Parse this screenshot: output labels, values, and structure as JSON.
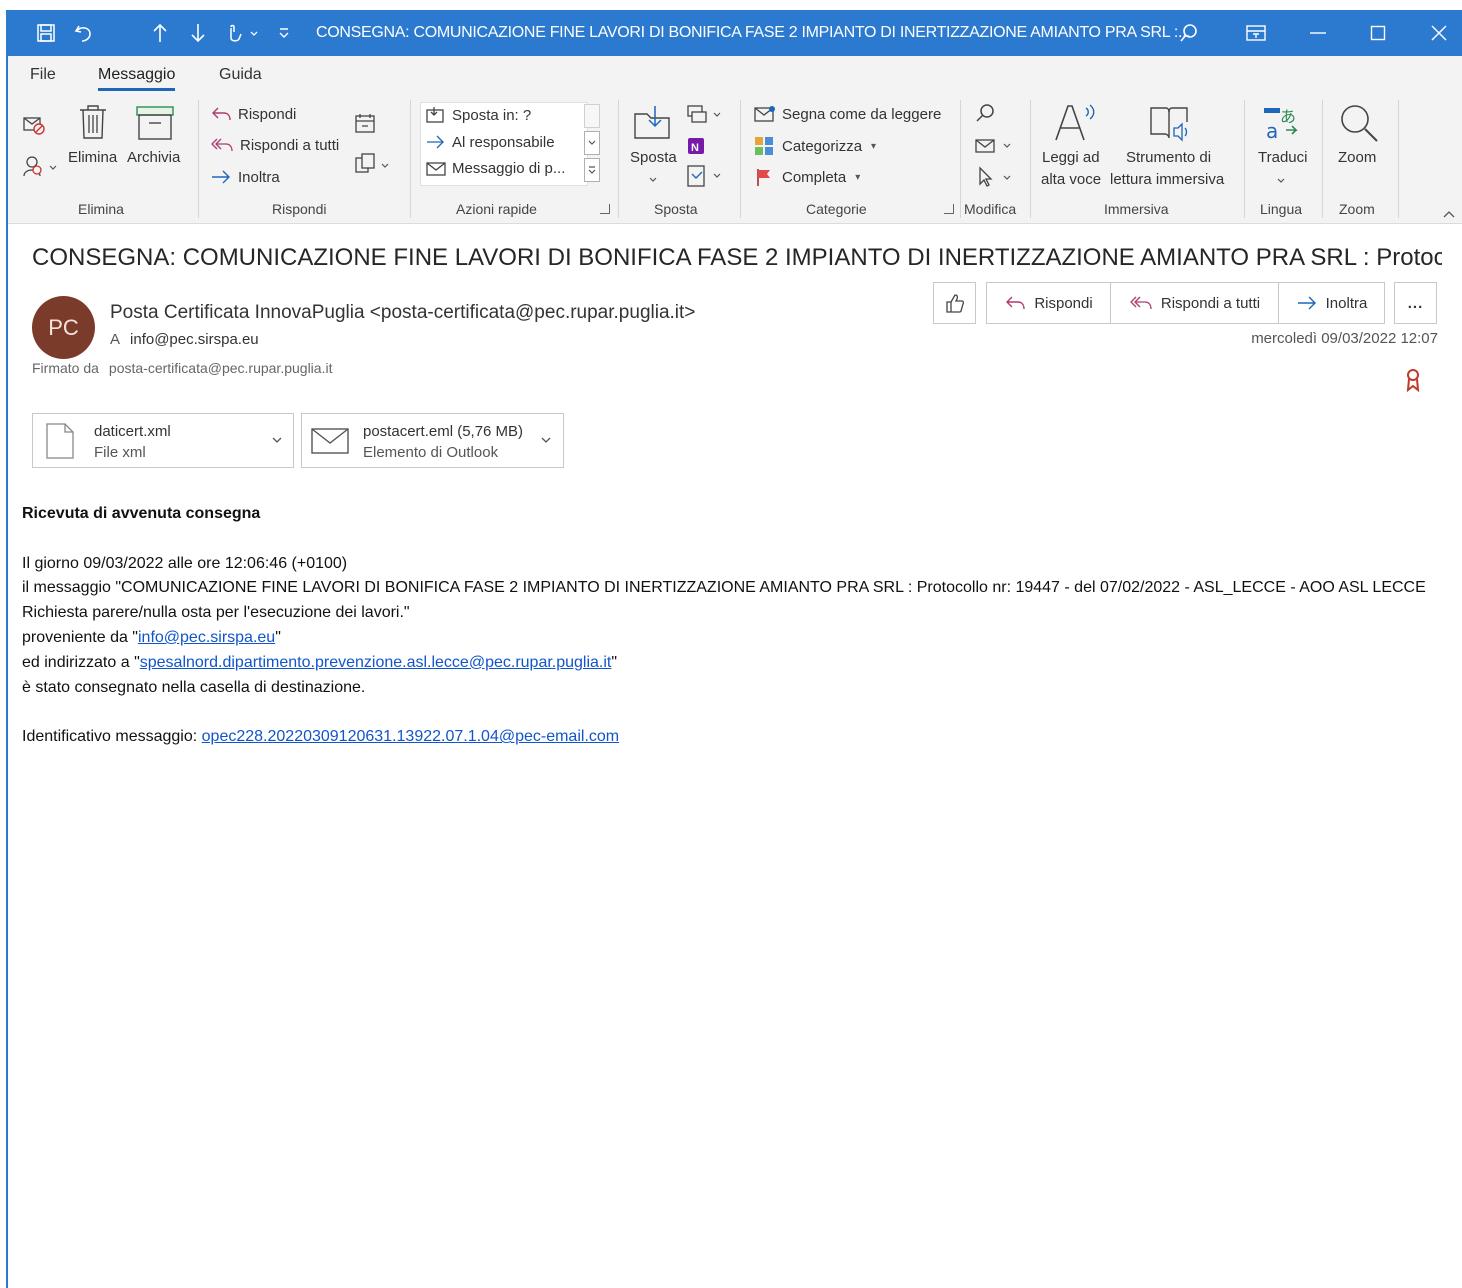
{
  "window": {
    "title": "CONSEGNA: COMUNICAZIONE FINE LAVORI DI BONIFICA FASE 2 IMPIANTO DI INERTIZZAZIONE AMIANTO PRA SRL :...",
    "accent_color": "#2b7ad0"
  },
  "menu": {
    "tabs": [
      "File",
      "Messaggio",
      "Guida"
    ],
    "active": "Messaggio"
  },
  "ribbon": {
    "elimina": {
      "delete_label": "Elimina",
      "archive_label": "Archivia",
      "group": "Elimina"
    },
    "rispondi": {
      "reply": "Rispondi",
      "reply_all": "Rispondi a tutti",
      "forward": "Inoltra",
      "group": "Rispondi"
    },
    "azioni_rapide": {
      "move_to": "Sposta in: ?",
      "to_manager": "Al responsabile",
      "team_email": "Messaggio di p...",
      "group": "Azioni rapide"
    },
    "sposta": {
      "move_label": "Sposta",
      "group": "Sposta"
    },
    "categorie": {
      "mark_unread": "Segna come da leggere",
      "categorize": "Categorizza",
      "follow_up": "Completa",
      "group": "Categorie"
    },
    "modifica": {
      "group": "Modifica"
    },
    "immersiva": {
      "read_aloud_line1": "Leggi ad",
      "read_aloud_line2": "alta voce",
      "immersive_line1": "Strumento di",
      "immersive_line2": "lettura immersiva",
      "group": "Immersiva"
    },
    "lingua": {
      "translate": "Traduci",
      "group": "Lingua"
    },
    "zoom": {
      "zoom_label": "Zoom",
      "group": "Zoom"
    }
  },
  "message": {
    "subject": "CONSEGNA: COMUNICAZIONE FINE LAVORI DI BONIFICA FASE 2 IMPIANTO DI INERTIZZAZIONE AMIANTO PRA SRL : Protocol...",
    "avatar_initials": "PC",
    "avatar_color": "#7b3b2a",
    "sender": "Posta Certificata InnovaPuglia <posta-certificata@pec.rupar.puglia.it>",
    "to_label": "A",
    "to": "info@pec.sirspa.eu",
    "signed_label": "Firmato da",
    "signed_by": "posta-certificata@pec.rupar.puglia.it",
    "datetime": "mercoledì 09/03/2022 12:07",
    "actions": {
      "reply": "Rispondi",
      "reply_all": "Rispondi a tutti",
      "forward": "Inoltra",
      "more": "..."
    },
    "attachments": [
      {
        "name": "daticert.xml",
        "meta": "File xml"
      },
      {
        "name": "postacert.eml (5,76 MB)",
        "meta": "Elemento di Outlook"
      }
    ]
  },
  "body": {
    "heading": "Ricevuta di avvenuta consegna",
    "line1": "Il giorno 09/03/2022 alle ore 12:06:46 (+0100)",
    "line2": "il messaggio \"COMUNICAZIONE FINE LAVORI DI BONIFICA FASE 2 IMPIANTO DI INERTIZZAZIONE AMIANTO PRA SRL : Protocollo nr: 19447 - del 07/02/2022 - ASL_LECCE - AOO ASL LECCE Richiesta parere/nulla osta per l'esecuzione dei lavori.\"",
    "from_prefix": "proveniente da \"",
    "from_link": "info@pec.sirspa.eu",
    "from_suffix": "\"",
    "to_prefix": "ed indirizzato a \"",
    "to_link": "spesalnord.dipartimento.prevenzione.asl.lecce@pec.rupar.puglia.it",
    "to_suffix": "\"",
    "delivered": "è stato consegnato nella casella di destinazione.",
    "id_prefix": "Identificativo messaggio: ",
    "id_link": "opec228.20220309120631.13922.07.1.04@pec-email.com"
  }
}
